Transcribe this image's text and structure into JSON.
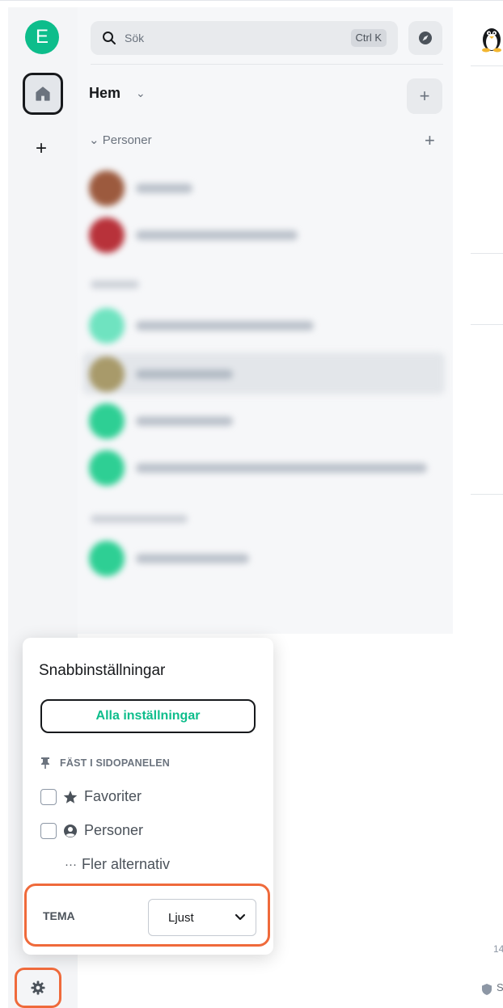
{
  "spaces": {
    "user_initial": "E",
    "add_space_symbol": "+",
    "home_icon": "home-icon",
    "settings_icon": "gear-icon"
  },
  "search": {
    "placeholder": "Sök",
    "shortcut": "Ctrl K",
    "icon": "search-icon",
    "explore_icon": "compass-icon"
  },
  "home": {
    "title": "Hem",
    "chevron": "⌄",
    "add_symbol": "+"
  },
  "section": {
    "label": "⌄ Personer",
    "add_symbol": "+"
  },
  "quick_settings": {
    "title": "Snabbinställningar",
    "all_settings_label": "Alla inställningar",
    "pin_heading": "FÄST I SIDOPANELEN",
    "options": [
      {
        "label": "Favoriter",
        "checked": false,
        "icon": "star-icon"
      },
      {
        "label": "Personer",
        "checked": false,
        "icon": "person-icon"
      }
    ],
    "more_dots": "···",
    "more_label": "Fler alternativ",
    "theme_label": "TEMA",
    "theme_value": "Ljust"
  },
  "timeline": {
    "partial_number": "14",
    "partial_text": "S"
  },
  "colors": {
    "accent": "#0dbd8b",
    "highlight": "#ef6a3b",
    "text": "#17191c",
    "muted": "#6b737e"
  }
}
